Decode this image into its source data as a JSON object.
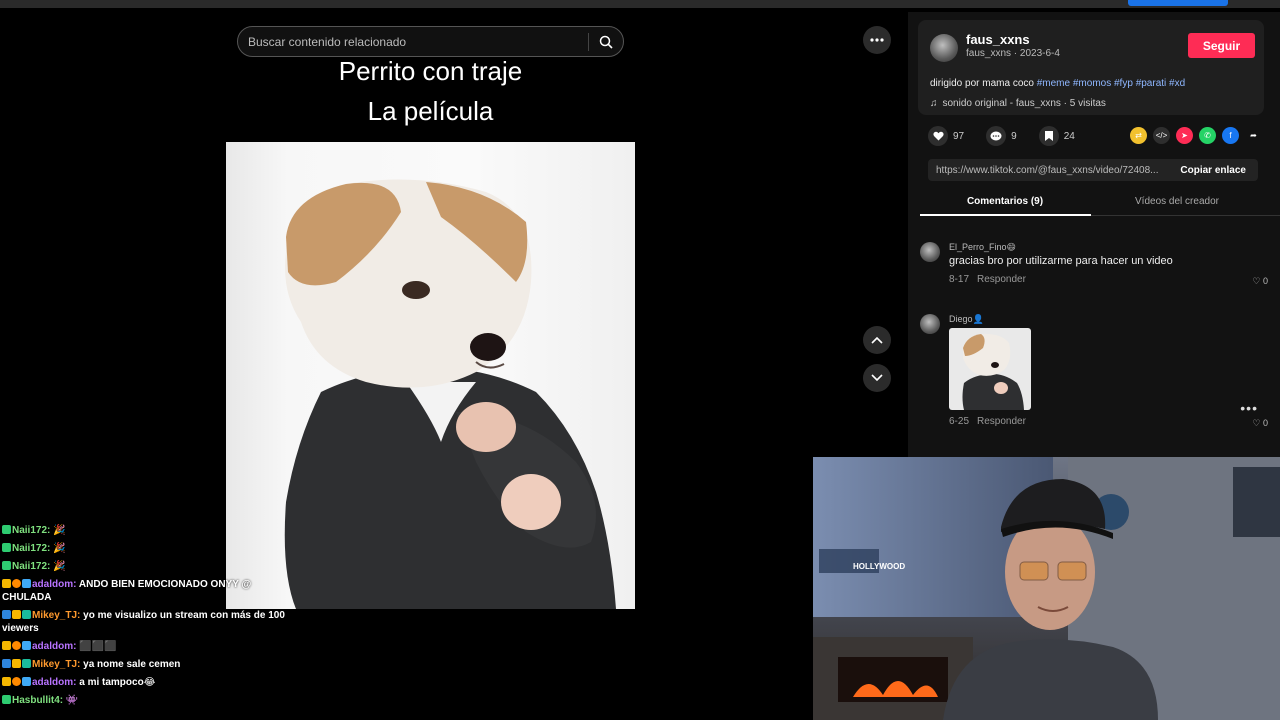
{
  "search": {
    "placeholder": "Buscar contenido relacionado"
  },
  "video": {
    "title_line1": "Perrito con traje",
    "title_line2": "La película"
  },
  "author": {
    "name": "faus_xxns",
    "handle": "faus_xxns",
    "date": "2023-6-4",
    "follow_label": "Seguir"
  },
  "description": {
    "text": "dirigido por mama coco",
    "tags": [
      "#meme",
      "#momos",
      "#fyp",
      "#parati",
      "#xd"
    ]
  },
  "music": "sonido original - faus_xxns · 5 visitas",
  "stats": {
    "likes": "97",
    "comments": "9",
    "saves": "24"
  },
  "link": {
    "url": "https://www.tiktok.com/@faus_xxns/video/72408...",
    "copy_label": "Copiar enlace"
  },
  "tabs": [
    {
      "label": "Comentarios (9)"
    },
    {
      "label": "Vídeos del creador"
    }
  ],
  "comments": [
    {
      "user": "El_Perro_Fino😄",
      "text": "gracias bro por utilizarme para hacer un video",
      "date": "8-17",
      "reply": "Responder",
      "likes": "0"
    },
    {
      "user": "Diego👤",
      "text": "",
      "date": "6-25",
      "reply": "Responder",
      "likes": "0"
    }
  ],
  "chat": [
    {
      "user": "Naii172:",
      "text": "🎉",
      "color": "#7fe07f"
    },
    {
      "user": "Naii172:",
      "text": "🎉",
      "color": "#7fe07f"
    },
    {
      "user": "Naii172:",
      "text": "🎉",
      "color": "#7fe07f"
    },
    {
      "user": "adaldom:",
      "text": "ANDO BIEN EMOCIONADO ONYY @ CHULADA",
      "color": "#b873ff"
    },
    {
      "user": "Mikey_TJ:",
      "text": "yo me visualizo un stream con más de 100 viewers",
      "color": "#ff9a2e"
    },
    {
      "user": "adaldom:",
      "text": "⬛⬛⬛",
      "color": "#b873ff"
    },
    {
      "user": "Mikey_TJ:",
      "text": "ya nome sale cemen",
      "color": "#ff9a2e"
    },
    {
      "user": "adaldom:",
      "text": "a mi tampoco😂",
      "color": "#b873ff"
    },
    {
      "user": "Hasbullit4:",
      "text": "👾",
      "color": "#7fe07f"
    }
  ],
  "webcam": {
    "sign_text": "HOLLYWOOD"
  },
  "colors": {
    "accent": "#fe2c55",
    "tag": "#8fb7ff",
    "panel": "#121212"
  }
}
